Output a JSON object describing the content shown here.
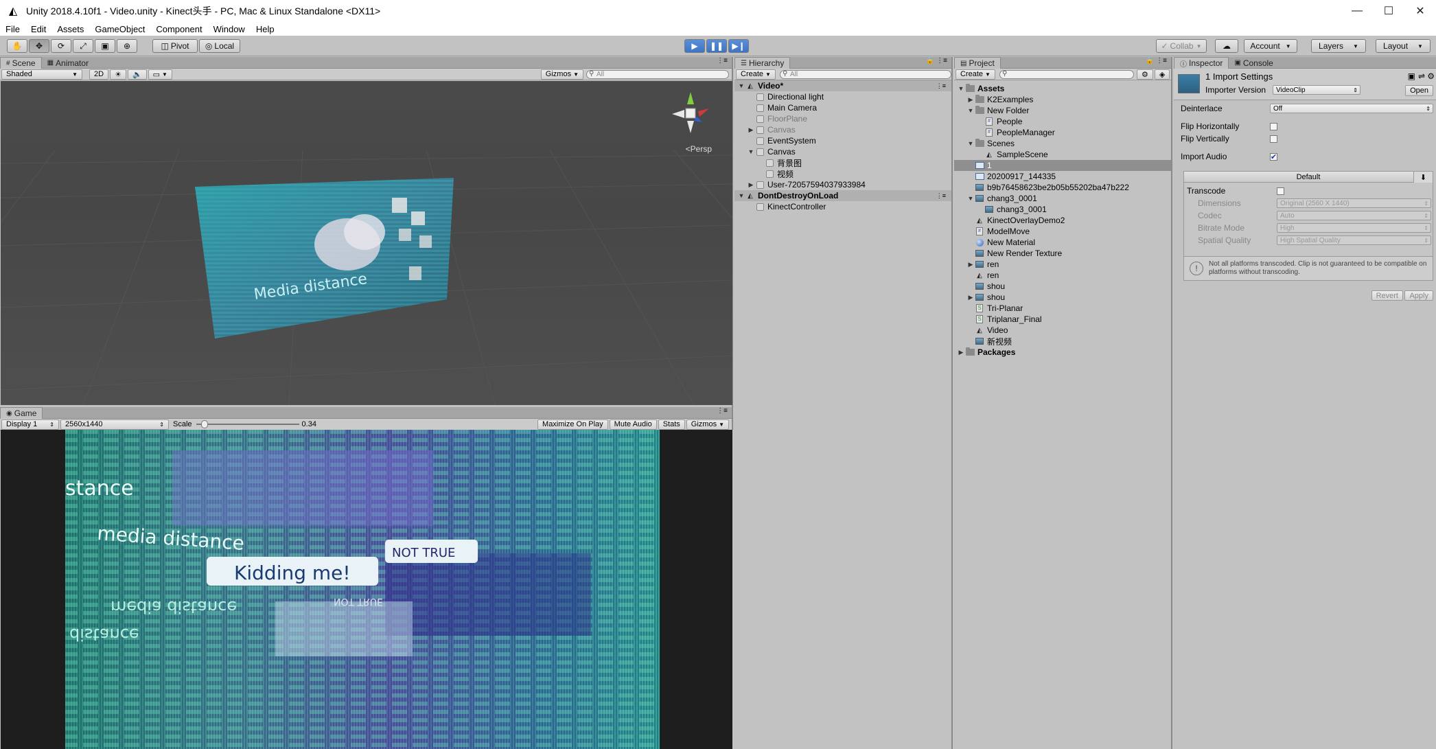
{
  "window": {
    "title": "Unity 2018.4.10f1 - Video.unity - Kinect头手 - PC, Mac & Linux Standalone <DX11>"
  },
  "menu": [
    "File",
    "Edit",
    "Assets",
    "GameObject",
    "Component",
    "Window",
    "Help"
  ],
  "toolbar": {
    "pivot": "Pivot",
    "local": "Local",
    "collab": "Collab",
    "account": "Account",
    "layers": "Layers",
    "layout": "Layout"
  },
  "scene": {
    "tab": "Scene",
    "animator_tab": "Animator",
    "shading": "Shaded",
    "mode2d": "2D",
    "gizmos": "Gizmos",
    "search": "All",
    "persp": "Persp",
    "overlay_text": "Media distance"
  },
  "game": {
    "tab": "Game",
    "display": "Display 1",
    "resolution": "2560x1440",
    "scale_label": "Scale",
    "scale_value": "0.34",
    "scale_fraction": 0.05,
    "maximize": "Maximize On Play",
    "mute": "Mute Audio",
    "stats": "Stats",
    "gizmos": "Gizmos",
    "words": [
      "stance",
      "media distance",
      "Kidding me!",
      "NOT TRUE",
      "media distance",
      "distance",
      "NOT TRUE"
    ]
  },
  "hierarchy": {
    "tab": "Hierarchy",
    "create": "Create",
    "search": "All",
    "rows": [
      {
        "label": "Video*",
        "level": 0,
        "arrow": "▼",
        "icon": "unity",
        "header": true
      },
      {
        "label": "Directional light",
        "level": 1,
        "arrow": "",
        "icon": "cube"
      },
      {
        "label": "Main Camera",
        "level": 1,
        "arrow": "",
        "icon": "cube"
      },
      {
        "label": "FloorPlane",
        "level": 1,
        "arrow": "",
        "icon": "cube",
        "dim": true
      },
      {
        "label": "Canvas",
        "level": 1,
        "arrow": "▶",
        "icon": "cube",
        "dim": true
      },
      {
        "label": "EventSystem",
        "level": 1,
        "arrow": "",
        "icon": "cube"
      },
      {
        "label": "Canvas",
        "level": 1,
        "arrow": "▼",
        "icon": "cube"
      },
      {
        "label": "背景图",
        "level": 2,
        "arrow": "",
        "icon": "cube"
      },
      {
        "label": "视频",
        "level": 2,
        "arrow": "",
        "icon": "cube"
      },
      {
        "label": "User-72057594037933984",
        "level": 1,
        "arrow": "▶",
        "icon": "cube"
      },
      {
        "label": "DontDestroyOnLoad",
        "level": 0,
        "arrow": "▼",
        "icon": "unity",
        "header": true
      },
      {
        "label": "KinectController",
        "level": 1,
        "arrow": "",
        "icon": "cube"
      }
    ]
  },
  "project": {
    "tab": "Project",
    "create": "Create",
    "rows": [
      {
        "label": "Assets",
        "level": 0,
        "arrow": "▼",
        "icon": "folder",
        "bold": true
      },
      {
        "label": "K2Examples",
        "level": 1,
        "arrow": "▶",
        "icon": "folder"
      },
      {
        "label": "New Folder",
        "level": 1,
        "arrow": "▼",
        "icon": "folder"
      },
      {
        "label": "People",
        "level": 2,
        "arrow": "",
        "icon": "script"
      },
      {
        "label": "PeopleManager",
        "level": 2,
        "arrow": "",
        "icon": "script"
      },
      {
        "label": "Scenes",
        "level": 1,
        "arrow": "▼",
        "icon": "folder"
      },
      {
        "label": "SampleScene",
        "level": 2,
        "arrow": "",
        "icon": "unity"
      },
      {
        "label": "1",
        "level": 1,
        "arrow": "",
        "icon": "video",
        "selected": true
      },
      {
        "label": "20200917_144335",
        "level": 1,
        "arrow": "",
        "icon": "video"
      },
      {
        "label": "b9b76458623be2b05b55202ba47b222",
        "level": 1,
        "arrow": "",
        "icon": "img"
      },
      {
        "label": "chang3_0001",
        "level": 1,
        "arrow": "▼",
        "icon": "img"
      },
      {
        "label": "chang3_0001",
        "level": 2,
        "arrow": "",
        "icon": "img"
      },
      {
        "label": "KinectOverlayDemo2",
        "level": 1,
        "arrow": "",
        "icon": "unity"
      },
      {
        "label": "ModelMove",
        "level": 1,
        "arrow": "",
        "icon": "script"
      },
      {
        "label": "New Material",
        "level": 1,
        "arrow": "",
        "icon": "sphere"
      },
      {
        "label": "New Render Texture",
        "level": 1,
        "arrow": "",
        "icon": "img"
      },
      {
        "label": "ren",
        "level": 1,
        "arrow": "▶",
        "icon": "img"
      },
      {
        "label": "ren",
        "level": 1,
        "arrow": "",
        "icon": "unity"
      },
      {
        "label": "shou",
        "level": 1,
        "arrow": "",
        "icon": "img"
      },
      {
        "label": "shou",
        "level": 1,
        "arrow": "▶",
        "icon": "img"
      },
      {
        "label": "Tri-Planar",
        "level": 1,
        "arrow": "",
        "icon": "shader"
      },
      {
        "label": "Triplanar_Final",
        "level": 1,
        "arrow": "",
        "icon": "shader"
      },
      {
        "label": "Video",
        "level": 1,
        "arrow": "",
        "icon": "unity"
      },
      {
        "label": "新视频",
        "level": 1,
        "arrow": "",
        "icon": "img"
      },
      {
        "label": "Packages",
        "level": 0,
        "arrow": "▶",
        "icon": "folder",
        "bold": true
      }
    ]
  },
  "inspector": {
    "tab": "Inspector",
    "console_tab": "Console",
    "title": "1 Import Settings",
    "importer_label": "Importer Version",
    "importer_value": "VideoClip",
    "open": "Open",
    "deinterlace_label": "Deinterlace",
    "deinterlace_value": "Off",
    "flip_h": "Flip Horizontally",
    "flip_v": "Flip Vertically",
    "import_audio": "Import Audio",
    "platform_tab": "Default",
    "transcode": "Transcode",
    "dimensions_label": "Dimensions",
    "dimensions_value": "Original (2560 X 1440)",
    "codec_label": "Codec",
    "codec_value": "Auto",
    "bitrate_label": "Bitrate Mode",
    "bitrate_value": "High",
    "quality_label": "Spatial Quality",
    "quality_value": "High Spatial Quality",
    "warning": "Not all platforms transcoded. Clip is not guaranteed to be compatible on platforms without transcoding.",
    "revert": "Revert",
    "apply": "Apply"
  }
}
